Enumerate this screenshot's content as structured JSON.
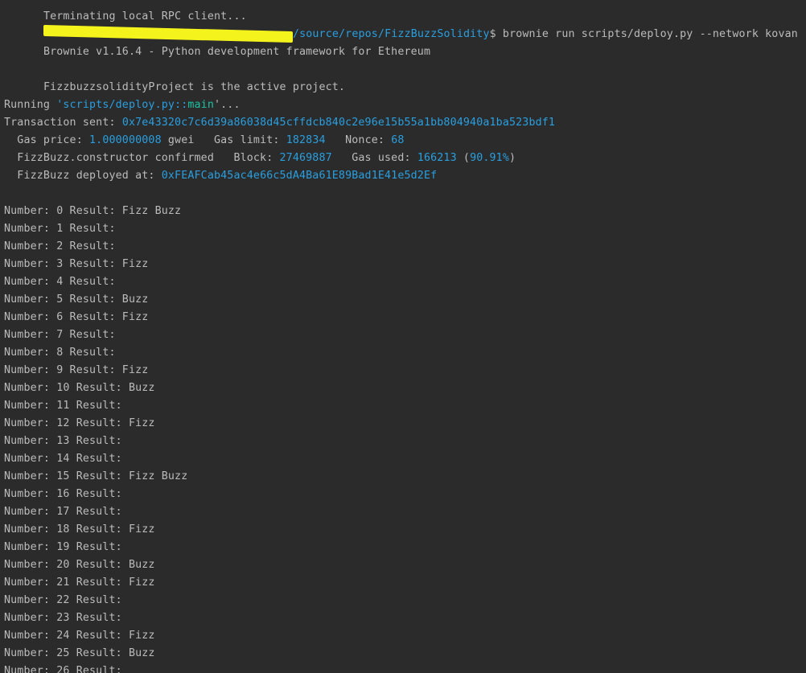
{
  "terminal": {
    "header_cut": "Terminating local RPC client...",
    "prompt_path": "/source/repos/FizzBuzzSolidity",
    "prompt_symbol": "$",
    "command": " brownie run scripts/deploy.py --network kovan",
    "brownie_banner": "Brownie v1.16.4 - Python development framework for Ethereum",
    "active_project": "FizzbuzzsolidityProject is the active project.",
    "running_prefix": "Running ",
    "running_script": "'scripts/deploy.py",
    "running_sep": "::",
    "running_func": "main",
    "running_end": "'...",
    "tx_label": "Transaction sent: ",
    "tx_hash": "0x7e43320c7c6d39a86038d45cffdcb840c2e96e15b55a1bb804940a1ba523bdf1",
    "gas_price_label": "  Gas price: ",
    "gas_price_value": "1.000000008",
    "gas_price_unit": " gwei   Gas limit: ",
    "gas_limit_value": "182834",
    "nonce_label": "   Nonce: ",
    "nonce_value": "68",
    "confirmed_label": "  FizzBuzz.constructor confirmed   Block: ",
    "block_value": "27469887",
    "gas_used_label": "   Gas used: ",
    "gas_used_value": "166213",
    "gas_used_open": " (",
    "gas_used_pct": "90.91%",
    "gas_used_close": ")",
    "deployed_label": "  FizzBuzz deployed at: ",
    "deployed_address": "0xFEAFCab45ac4e66c5dA4Ba61E89Bad1E41e5d2Ef",
    "results": [
      "Number: 0 Result: Fizz Buzz",
      "Number: 1 Result:",
      "Number: 2 Result:",
      "Number: 3 Result: Fizz",
      "Number: 4 Result:",
      "Number: 5 Result: Buzz",
      "Number: 6 Result: Fizz",
      "Number: 7 Result:",
      "Number: 8 Result:",
      "Number: 9 Result: Fizz",
      "Number: 10 Result: Buzz",
      "Number: 11 Result:",
      "Number: 12 Result: Fizz",
      "Number: 13 Result:",
      "Number: 14 Result:",
      "Number: 15 Result: Fizz Buzz",
      "Number: 16 Result:",
      "Number: 17 Result:",
      "Number: 18 Result: Fizz",
      "Number: 19 Result:",
      "Number: 20 Result: Buzz",
      "Number: 21 Result: Fizz",
      "Number: 22 Result:",
      "Number: 23 Result:",
      "Number: 24 Result: Fizz",
      "Number: 25 Result: Buzz",
      "Number: 26 Result:"
    ]
  },
  "colors": {
    "background": "#2b2b2b",
    "text": "#bbbbbb",
    "highlight": "#299fe0",
    "teal": "#1bc3a3",
    "redaction": "#f4f31c"
  }
}
